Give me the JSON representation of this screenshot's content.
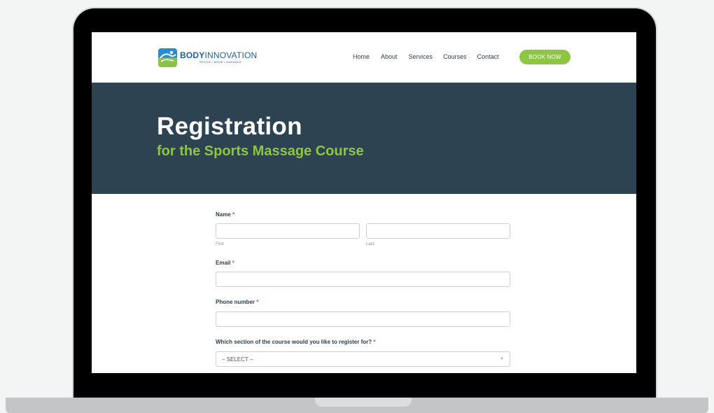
{
  "brand": {
    "name_bold": "BODY",
    "name_light": "INNOVATION",
    "tagline": "REVIVE • MOVE • ENHANCE",
    "logo_icon": "logo-mark-icon",
    "colors": {
      "primary_blue": "#1e5fa8",
      "accent_green": "#8dc63f",
      "hero_bg": "#2d4352"
    }
  },
  "nav": {
    "items": [
      {
        "label": "Home"
      },
      {
        "label": "About"
      },
      {
        "label": "Services"
      },
      {
        "label": "Courses"
      },
      {
        "label": "Contact"
      }
    ],
    "cta_label": "BOOK NOW"
  },
  "hero": {
    "title": "Registration",
    "subtitle": "for the Sports Massage Course"
  },
  "form": {
    "name": {
      "label": "Name",
      "required_mark": "*",
      "first_sub": "First",
      "last_sub": "Last",
      "first_value": "",
      "last_value": ""
    },
    "email": {
      "label": "Email",
      "required_mark": "*",
      "value": ""
    },
    "phone": {
      "label": "Phone number",
      "required_mark": "*",
      "value": ""
    },
    "section": {
      "label": "Which section of the course would you like to register for?",
      "required_mark": "*",
      "selected": "– SELECT –",
      "icon": "chevron-down-icon"
    }
  }
}
